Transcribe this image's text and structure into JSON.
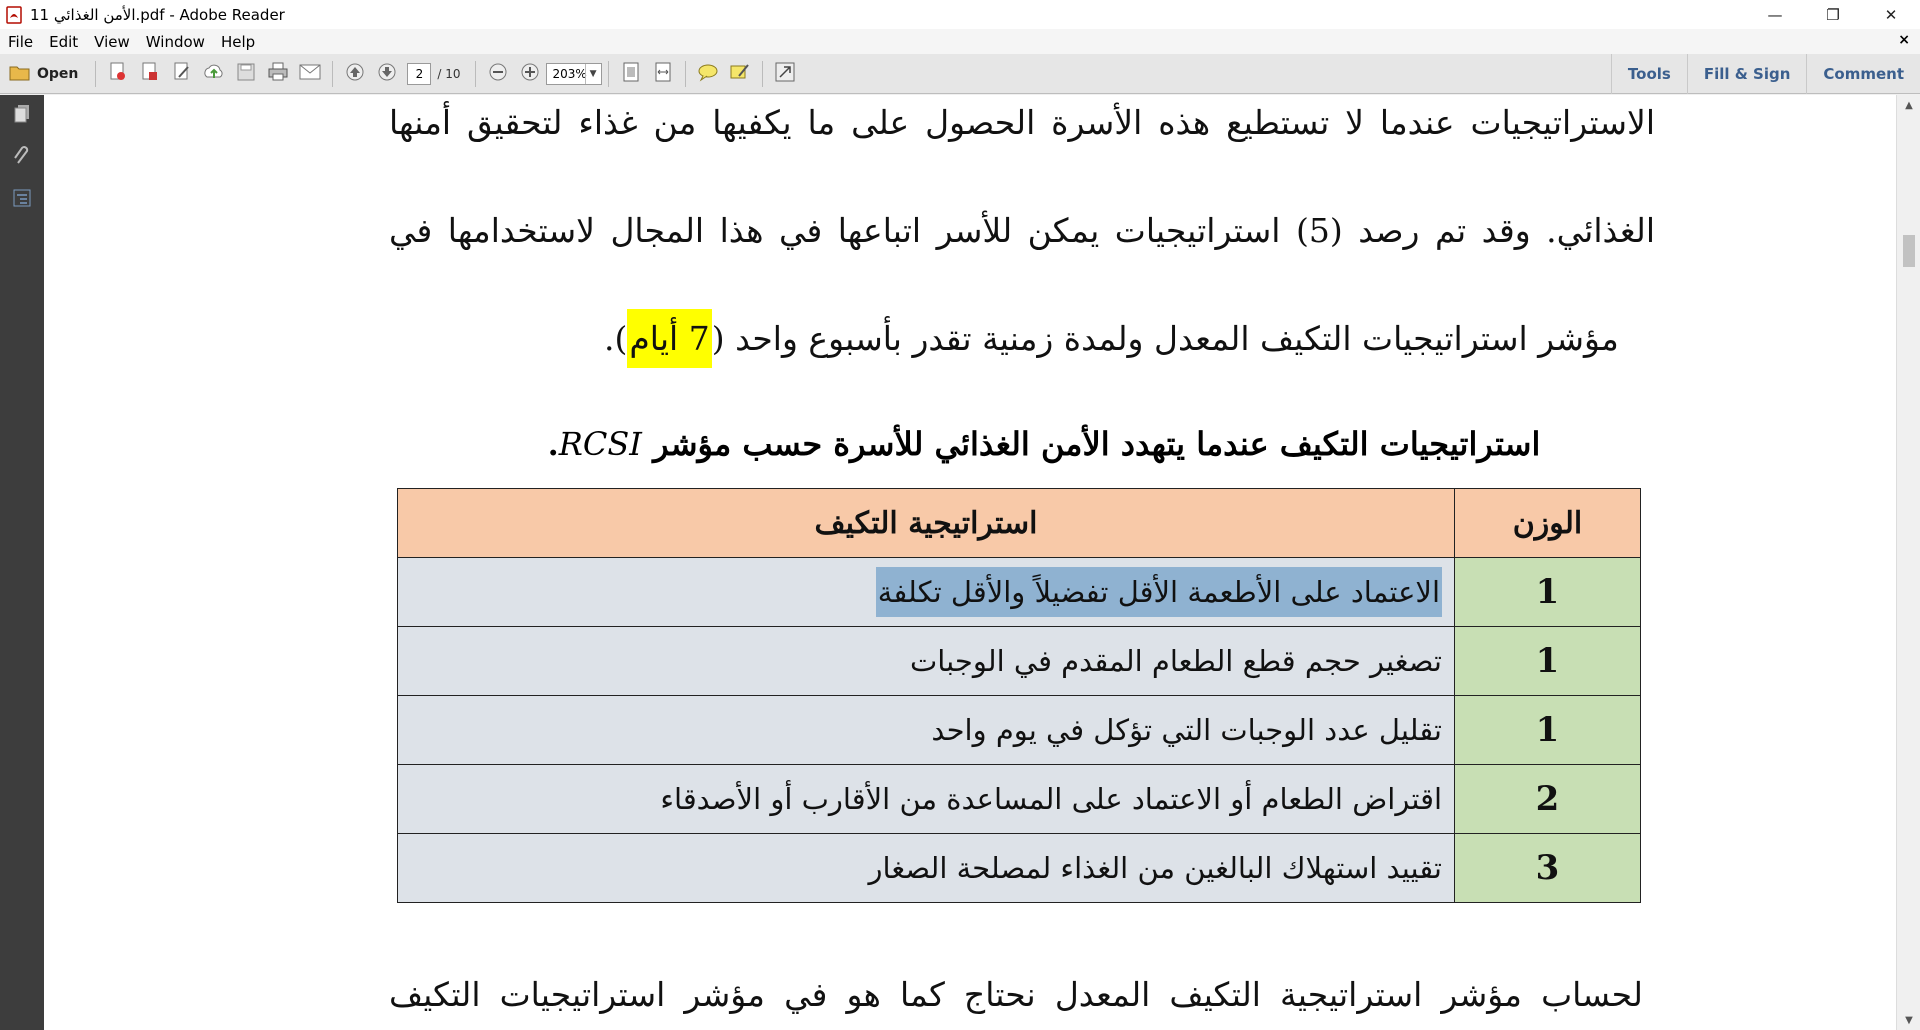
{
  "window": {
    "title": "الأمن الغذائي 11.pdf - Adobe Reader",
    "minimize": "—",
    "restore": "❐",
    "close": "✕"
  },
  "menu": {
    "items": [
      "File",
      "Edit",
      "View",
      "Window",
      "Help"
    ],
    "close": "×"
  },
  "toolbar": {
    "open_label": "Open",
    "page_current": "2",
    "page_total": "/ 10",
    "zoom": "203%",
    "right": [
      "Tools",
      "Fill & Sign",
      "Comment"
    ]
  },
  "document": {
    "para1_line1": "الاستراتيجيات عندما لا تستطيع هذه الأسرة الحصول على ما يكفيها من غذاء لتحقيق أمنها",
    "para1_line2": "الغذائي. وقد تم رصد (5) استراتيجيات يمكن للأسر اتباعها في هذا المجال لاستخدامها في",
    "para1_line3_pre": "مؤشر استراتيجيات التكيف المعدل ولمدة زمنية تقدر بأسبوع واحد (",
    "para1_line3_hl": "7 أيام",
    "para1_line3_post": ").",
    "heading_ar": "استراتيجيات التكيف عندما يتهدد الأمن الغذائي للأسرة حسب مؤشر",
    "heading_latin": "RCSI",
    "heading_end": ".",
    "table": {
      "col_weight": "الوزن",
      "col_strategy": "استراتيجية التكيف",
      "rows": [
        {
          "weight": "1",
          "strategy": "الاعتماد على الأطعمة الأقل تفضيلاً والأقل تكلفة"
        },
        {
          "weight": "1",
          "strategy": "تصغير حجم قطع الطعام المقدم في الوجبات"
        },
        {
          "weight": "1",
          "strategy": "تقليل عدد الوجبات التي تؤكل في يوم واحد"
        },
        {
          "weight": "2",
          "strategy": "اقتراض الطعام أو الاعتماد على المساعدة من الأقارب أو الأصدقاء"
        },
        {
          "weight": "3",
          "strategy": "تقييد استهلاك البالغين من الغذاء لمصلحة الصغار"
        }
      ]
    },
    "para2_line1": "لحساب مؤشر استراتيجية التكيف المعدل نحتاج كما هو في مؤشر استراتيجيات التكيف"
  },
  "colors": {
    "header_bg": "#f8c9a8",
    "weight_bg": "#c8dfb4",
    "strategy_bg": "#dde2e8",
    "highlight": "#ffff00",
    "selection": "#8fb2d1"
  }
}
